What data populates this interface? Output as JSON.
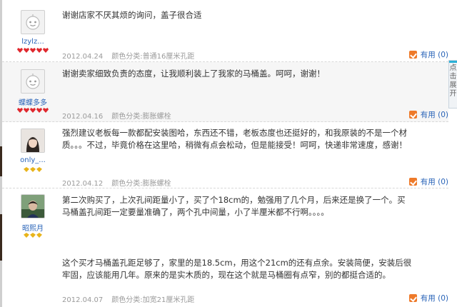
{
  "useful_label": "有用",
  "side_tab": {
    "label": "点击展开"
  },
  "reviews": [
    {
      "username": "lzylz...",
      "comment": "谢谢店家不厌其烦的询问，盖子很合适",
      "comment_extra": "",
      "date": "2012.04.24",
      "variant_label": "颜色分类:",
      "variant": "普通16厘米孔距",
      "useful_count": "(0)",
      "rank_icon": "heart",
      "rank_count": 5
    },
    {
      "username": "蝶蝶多多",
      "comment": "谢谢卖家细致负责的态度，让我顺利装上了我家的马桶盖。呵呵，谢谢！",
      "comment_extra": "",
      "date": "2012.04.16",
      "variant_label": "颜色分类:",
      "variant": "膨胀螺栓",
      "useful_count": "(0)",
      "rank_icon": "heart",
      "rank_count": 5
    },
    {
      "username": "only_...",
      "comment": "强烈建议老板每一款都配安装图哈，东西还不错，老板态度也还挺好的，和我原装的不是一个材质。。。不过，毕竟价格在这里哈，稍微有点会松动，但是能接受！呵呵，快递非常速度，感谢！",
      "comment_extra": "",
      "date": "2012.04.12",
      "variant_label": "颜色分类:",
      "variant": "膨胀螺栓",
      "useful_count": "(0)",
      "rank_icon": "diamond",
      "rank_count": 3
    },
    {
      "username": "昭熙月",
      "comment": "第二次购买了，上次孔间距量小了，买了个18cm的，勉强用了几个月，后来还是换了一个。买马桶盖孔间距一定要量准确了，两个孔中间量，小了半厘米都不行啊。。。。",
      "comment_extra": "这个买才马桶盖孔距足够了，家里的是18.5cm，用这个21cm的还有点余。安装简便，安装后很牢固，应该能用几年。原来的是实木质的，现在这个就是马桶圈有点窄，别的都挺合适的。",
      "date": "2012.04.07",
      "variant_label": "颜色分类:",
      "variant": "加宽21厘米孔距",
      "useful_count": "(0)",
      "rank_icon": "diamond",
      "rank_count": 3
    }
  ]
}
